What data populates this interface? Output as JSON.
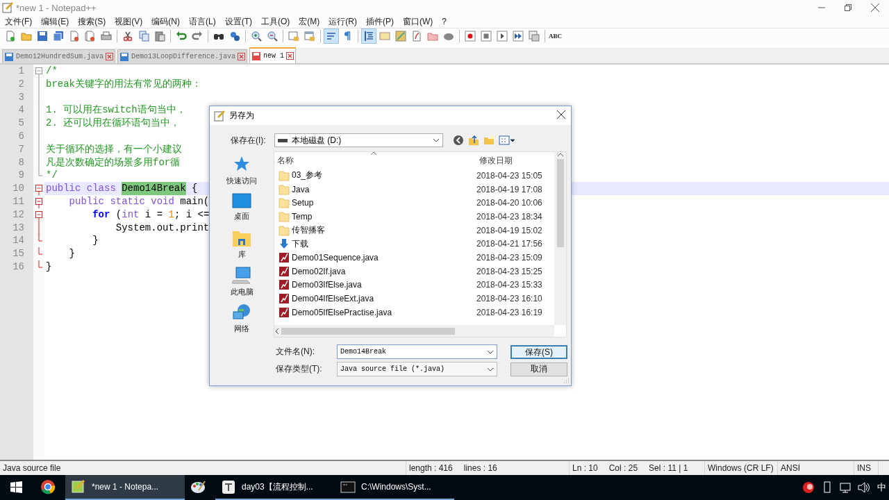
{
  "window": {
    "title": "*new 1 - Notepad++"
  },
  "menu": [
    "文件(F)",
    "编辑(E)",
    "搜索(S)",
    "视图(V)",
    "编码(N)",
    "语言(L)",
    "设置(T)",
    "工具(O)",
    "宏(M)",
    "运行(R)",
    "插件(P)",
    "窗口(W)",
    "?"
  ],
  "toolbar": {
    "spellcheck_label": "ABC"
  },
  "tabs": [
    {
      "label": "Demo12HundredSum.java",
      "selected": false,
      "modified": false
    },
    {
      "label": "Demo13LoopDifference.java",
      "selected": false,
      "modified": false
    },
    {
      "label": "new 1",
      "selected": true,
      "modified": true
    }
  ],
  "editor": {
    "lines": [
      {
        "number": "1",
        "kind": "fold_start",
        "fold_highlight": false,
        "current": false,
        "tokens": [
          {
            "kind": "comment",
            "text": "/*"
          }
        ]
      },
      {
        "number": "2",
        "kind": "fold_body",
        "fold_highlight": false,
        "current": false,
        "tokens": [
          {
            "kind": "comment",
            "text": "break关键字的用法有常见的两种："
          }
        ]
      },
      {
        "number": "3",
        "kind": "fold_body",
        "fold_highlight": false,
        "current": false
      },
      {
        "number": "4",
        "kind": "fold_body",
        "fold_highlight": false,
        "current": false,
        "tokens": [
          {
            "kind": "comment",
            "text": "1. 可以用在switch语句当中，"
          }
        ]
      },
      {
        "number": "5",
        "kind": "fold_body",
        "fold_highlight": false,
        "current": false,
        "tokens": [
          {
            "kind": "comment",
            "text": "2. 还可以用在循环语句当中，"
          }
        ]
      },
      {
        "number": "6",
        "kind": "fold_body",
        "fold_highlight": false,
        "current": false
      },
      {
        "number": "7",
        "kind": "fold_body",
        "fold_highlight": false,
        "current": false,
        "tokens": [
          {
            "kind": "comment",
            "text": "关于循环的选择，有一个小建议"
          }
        ]
      },
      {
        "number": "8",
        "kind": "fold_body",
        "fold_highlight": false,
        "current": false,
        "tokens": [
          {
            "kind": "comment",
            "text": "凡是次数确定的场景多用for循"
          }
        ]
      },
      {
        "number": "9",
        "kind": "fold_end",
        "fold_highlight": false,
        "current": false,
        "tokens": [
          {
            "kind": "comment",
            "text": "*/"
          }
        ]
      },
      {
        "number": "10",
        "kind": "fold_start",
        "fold_highlight": true,
        "current": true,
        "tokens": [
          {
            "kind": "modifier",
            "text": "public class "
          },
          {
            "kind": "match",
            "text": "Demo14Break"
          },
          {
            "kind": "plain",
            "text": " {"
          }
        ]
      },
      {
        "number": "11",
        "kind": "fold_start",
        "fold_highlight": true,
        "current": false,
        "tokens": [
          {
            "kind": "modifier",
            "text": "    public static void "
          },
          {
            "kind": "plain",
            "text": "main("
          }
        ]
      },
      {
        "number": "12",
        "kind": "fold_start",
        "fold_highlight": true,
        "current": false,
        "tokens": [
          {
            "kind": "keyword",
            "text": "        for"
          },
          {
            "kind": "plain",
            "text": " ("
          },
          {
            "kind": "modifier",
            "text": "int"
          },
          {
            "kind": "plain",
            "text": " i = "
          },
          {
            "kind": "number",
            "text": "1"
          },
          {
            "kind": "plain",
            "text": "; i <="
          }
        ]
      },
      {
        "number": "13",
        "kind": "fold_body",
        "fold_highlight": true,
        "current": false,
        "tokens": [
          {
            "kind": "plain",
            "text": "            System.out.print"
          }
        ]
      },
      {
        "number": "14",
        "kind": "fold_end",
        "fold_highlight": true,
        "current": false,
        "tokens": [
          {
            "kind": "plain",
            "text": "        }"
          }
        ]
      },
      {
        "number": "15",
        "kind": "fold_end",
        "fold_highlight": true,
        "current": false,
        "tokens": [
          {
            "kind": "plain",
            "text": "    }"
          }
        ]
      },
      {
        "number": "16",
        "kind": "fold_end",
        "fold_highlight": true,
        "current": false,
        "tokens": [
          {
            "kind": "plain",
            "text": "}"
          }
        ]
      }
    ]
  },
  "dialog": {
    "title": "另存为",
    "location_label": "保存在(I):",
    "location": "本地磁盘 (D:)",
    "places": [
      {
        "label": "快速访问",
        "kind": "star"
      },
      {
        "label": "桌面",
        "kind": "desktop"
      },
      {
        "label": "库",
        "kind": "library"
      },
      {
        "label": "此电脑",
        "kind": "computer"
      },
      {
        "label": "网络",
        "kind": "network"
      }
    ],
    "columns": [
      "名称",
      "修改日期"
    ],
    "files": [
      {
        "name": "03_参考",
        "date": "2018-04-23 15:05",
        "kind": "folder"
      },
      {
        "name": "Java",
        "date": "2018-04-19 17:08",
        "kind": "folder"
      },
      {
        "name": "Setup",
        "date": "2018-04-20 10:06",
        "kind": "folder"
      },
      {
        "name": "Temp",
        "date": "2018-04-23 18:34",
        "kind": "folder"
      },
      {
        "name": "传智播客",
        "date": "2018-04-19 15:02",
        "kind": "folder"
      },
      {
        "name": "下载",
        "date": "2018-04-21 17:56",
        "kind": "download"
      },
      {
        "name": "Demo01Sequence.java",
        "date": "2018-04-23 15:09",
        "kind": "java"
      },
      {
        "name": "Demo02If.java",
        "date": "2018-04-23 15:25",
        "kind": "java"
      },
      {
        "name": "Demo03IfElse.java",
        "date": "2018-04-23 15:33",
        "kind": "java"
      },
      {
        "name": "Demo04IfElseExt.java",
        "date": "2018-04-23 16:10",
        "kind": "java"
      },
      {
        "name": "Demo05IfElsePractise.java",
        "date": "2018-04-23 16:19",
        "kind": "java"
      }
    ],
    "filename_label": "文件名(N):",
    "filename": "Demo14Break",
    "type_label": "保存类型(T):",
    "type": "Java source file (*.java)",
    "buttons": [
      {
        "label": "保存(S)",
        "default": true
      },
      {
        "label": "取消",
        "default": false
      }
    ]
  },
  "status_bar": [
    [
      "Java source file"
    ],
    [
      "length : 416",
      "lines : 16"
    ],
    [
      "Ln : 10",
      "Col : 25",
      "Sel : 11 | 1"
    ],
    [
      "Windows (CR LF)"
    ],
    [
      "ANSI"
    ],
    [
      "INS"
    ]
  ],
  "taskbar": {
    "items": [
      {
        "kind": "start",
        "active": false
      },
      {
        "kind": "browser",
        "active": false
      },
      {
        "kind": "notepad",
        "label": "*new 1 - Notepa...",
        "active": true
      },
      {
        "kind": "paint",
        "active": false
      },
      {
        "kind": "text",
        "label": "day03【流程控制...",
        "active": false
      },
      {
        "kind": "console",
        "label": "C:\\Windows\\Syst...",
        "active": false
      }
    ],
    "tray_language": "中"
  }
}
